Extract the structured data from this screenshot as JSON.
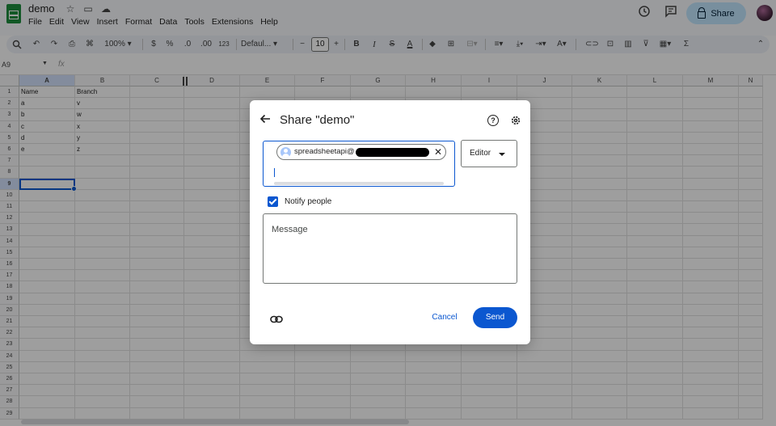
{
  "app": {
    "title": "demo",
    "menu": [
      "File",
      "Edit",
      "View",
      "Insert",
      "Format",
      "Data",
      "Tools",
      "Extensions",
      "Help"
    ],
    "share_label": "Share"
  },
  "toolbar": {
    "zoom": "100%",
    "currency": "$",
    "percent": "%",
    "dec_decrease": ".0",
    "dec_increase": ".00",
    "format_123": "123",
    "font": "Defaul...",
    "font_size": "10",
    "bold": "B",
    "italic": "I",
    "strike": "S",
    "text_color": "A",
    "sigma": "Σ"
  },
  "formula_bar": {
    "name_box": "A9",
    "fx": "fx"
  },
  "grid": {
    "columns": [
      "A",
      "B",
      "C",
      "D",
      "E",
      "F",
      "G",
      "H",
      "I",
      "J",
      "K",
      "L",
      "M",
      "N"
    ],
    "rows": [
      "1",
      "2",
      "3",
      "4",
      "5",
      "6",
      "7",
      "8",
      "9",
      "10",
      "11",
      "12",
      "13",
      "14",
      "15",
      "16",
      "17",
      "18",
      "19",
      "20",
      "21",
      "22",
      "23",
      "24",
      "25",
      "26",
      "27",
      "28",
      "29"
    ],
    "cells": [
      [
        "Name",
        "Branch"
      ],
      [
        "a",
        "v"
      ],
      [
        "b",
        "w"
      ],
      [
        "c",
        "x"
      ],
      [
        "d",
        "y"
      ],
      [
        "e",
        "z"
      ]
    ],
    "selected_cell": "A9"
  },
  "dialog": {
    "title": "Share \"demo\"",
    "chip_email_prefix": "spreadsheetapi@",
    "role": "Editor",
    "notify_label": "Notify people",
    "notify_checked": true,
    "message_placeholder": "Message",
    "cancel_label": "Cancel",
    "send_label": "Send"
  },
  "colors": {
    "accent": "#0b57d0",
    "share_bg": "#c2e7ff",
    "sheets_green": "#1e8e3e"
  }
}
